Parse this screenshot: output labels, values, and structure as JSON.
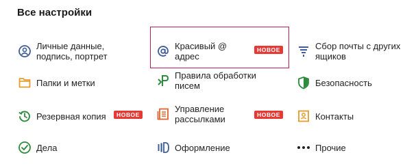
{
  "header": {
    "title": "Все настройки"
  },
  "badge_text": "НОВОЕ",
  "colors": {
    "badge": "#e53935",
    "highlight_border": "#c2185b",
    "blue_icon": "#3f5c9a",
    "orange_icon": "#e39b2a",
    "green_icon": "#2e8b3d"
  },
  "items": {
    "personal": {
      "label": "Личные данные, подпись, портрет",
      "icon": "person-icon"
    },
    "beautiful": {
      "label": "Красивый @ адрес",
      "icon": "at-icon",
      "new": true
    },
    "collect": {
      "label": "Сбор почты с других ящиков",
      "icon": "funnel-icon"
    },
    "folders": {
      "label": "Папки и метки",
      "icon": "folder-icon"
    },
    "rules": {
      "label": "Правила обработки писем",
      "icon": "rules-icon"
    },
    "security": {
      "label": "Безопасность",
      "icon": "shield-icon"
    },
    "backup": {
      "label": "Резервная копия",
      "icon": "backup-icon",
      "new": true
    },
    "mailing": {
      "label": "Управление рассылками",
      "icon": "newsletter-icon",
      "new": true
    },
    "contacts": {
      "label": "Контакты",
      "icon": "contacts-icon"
    },
    "tasks": {
      "label": "Дела",
      "icon": "check-icon"
    },
    "design": {
      "label": "Оформление",
      "icon": "design-icon"
    },
    "other": {
      "label": "Прочие",
      "icon": "dots-icon"
    }
  }
}
